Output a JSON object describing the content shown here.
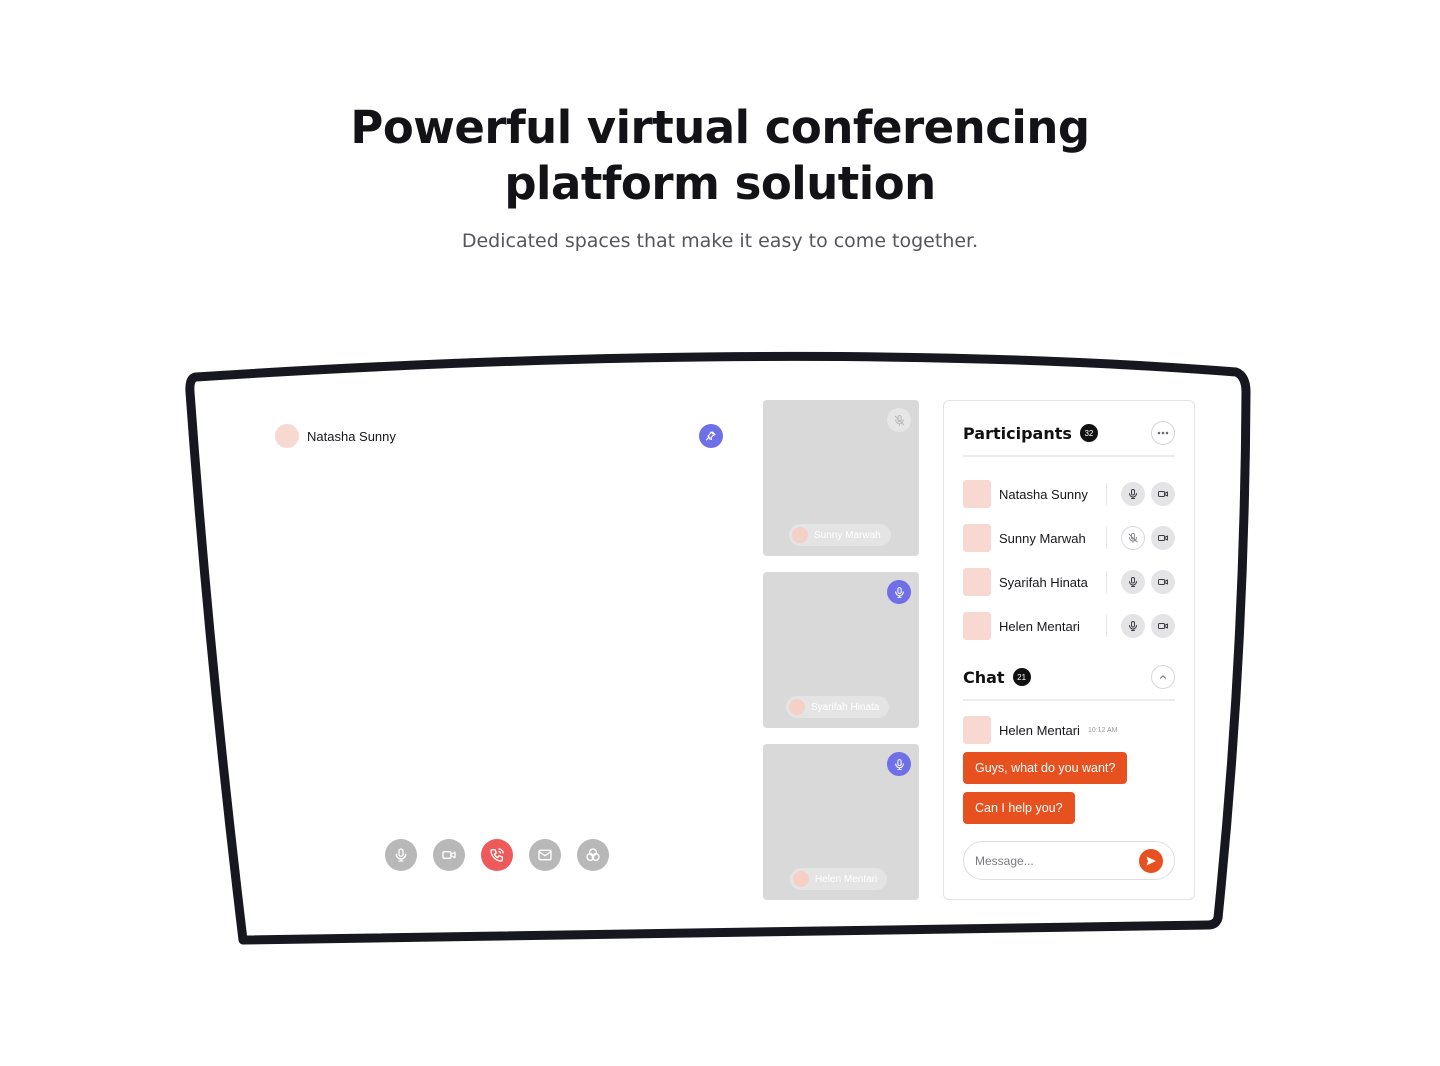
{
  "hero": {
    "title_line1": "Powerful virtual conferencing",
    "title_line2": "platform solution",
    "subtitle": "Dedicated spaces that make it easy to come together."
  },
  "main_video": {
    "speaker_name": "Natasha Sunny",
    "pin_icon": "pin-icon",
    "controls": [
      {
        "name": "mic-button",
        "icon": "mic-icon"
      },
      {
        "name": "camera-button",
        "icon": "video-camera-icon"
      },
      {
        "name": "end-call-button",
        "icon": "phone-icon"
      },
      {
        "name": "message-button",
        "icon": "envelope-icon"
      },
      {
        "name": "effects-button",
        "icon": "circles-icon"
      }
    ]
  },
  "tiles": [
    {
      "name": "Sunny Marwah",
      "mic": "muted"
    },
    {
      "name": "Syarifah Hinata",
      "mic": "on"
    },
    {
      "name": "Helen Mentari",
      "mic": "on"
    }
  ],
  "participants": {
    "title": "Participants",
    "count": "32",
    "list": [
      {
        "name": "Natasha Sunny",
        "mic": "on"
      },
      {
        "name": "Sunny Marwah",
        "mic": "muted"
      },
      {
        "name": "Syarifah Hinata",
        "mic": "on"
      },
      {
        "name": "Helen Mentari",
        "mic": "on"
      }
    ]
  },
  "chat": {
    "title": "Chat",
    "count": "21",
    "sender": "Helen Mentari",
    "time": "10:12 AM",
    "messages": [
      "Guys, what do you want?",
      "Can I help you?"
    ],
    "input_placeholder": "Message..."
  },
  "colors": {
    "accent_purple": "#6f6fe8",
    "accent_orange": "#e6511f",
    "end_call_red": "#ee5a5a",
    "avatar_peach": "#f8d9d2"
  }
}
